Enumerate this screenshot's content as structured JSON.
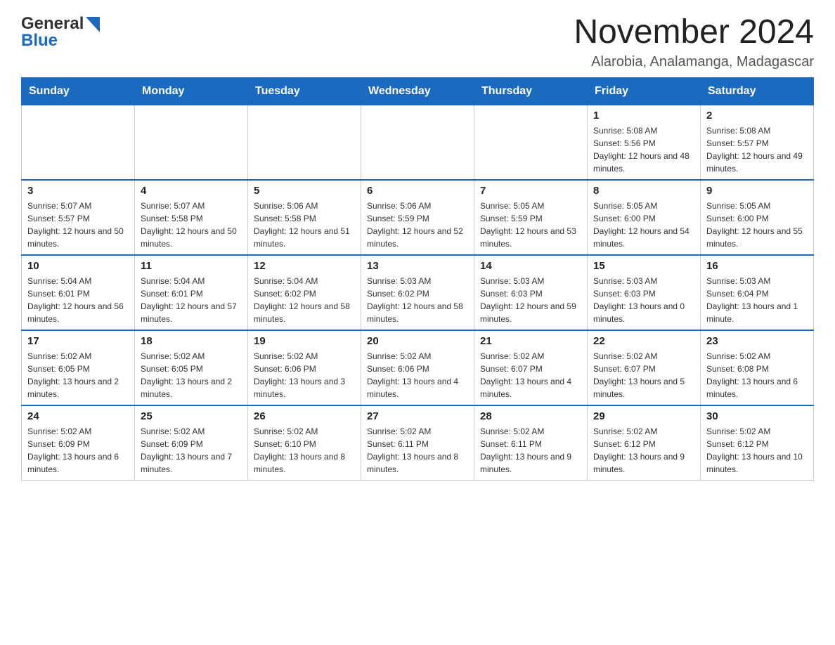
{
  "header": {
    "logo": {
      "general": "General",
      "blue": "Blue"
    },
    "title": "November 2024",
    "subtitle": "Alarobia, Analamanga, Madagascar"
  },
  "calendar": {
    "days_of_week": [
      "Sunday",
      "Monday",
      "Tuesday",
      "Wednesday",
      "Thursday",
      "Friday",
      "Saturday"
    ],
    "weeks": [
      [
        {
          "day": "",
          "info": ""
        },
        {
          "day": "",
          "info": ""
        },
        {
          "day": "",
          "info": ""
        },
        {
          "day": "",
          "info": ""
        },
        {
          "day": "",
          "info": ""
        },
        {
          "day": "1",
          "info": "Sunrise: 5:08 AM\nSunset: 5:56 PM\nDaylight: 12 hours and 48 minutes."
        },
        {
          "day": "2",
          "info": "Sunrise: 5:08 AM\nSunset: 5:57 PM\nDaylight: 12 hours and 49 minutes."
        }
      ],
      [
        {
          "day": "3",
          "info": "Sunrise: 5:07 AM\nSunset: 5:57 PM\nDaylight: 12 hours and 50 minutes."
        },
        {
          "day": "4",
          "info": "Sunrise: 5:07 AM\nSunset: 5:58 PM\nDaylight: 12 hours and 50 minutes."
        },
        {
          "day": "5",
          "info": "Sunrise: 5:06 AM\nSunset: 5:58 PM\nDaylight: 12 hours and 51 minutes."
        },
        {
          "day": "6",
          "info": "Sunrise: 5:06 AM\nSunset: 5:59 PM\nDaylight: 12 hours and 52 minutes."
        },
        {
          "day": "7",
          "info": "Sunrise: 5:05 AM\nSunset: 5:59 PM\nDaylight: 12 hours and 53 minutes."
        },
        {
          "day": "8",
          "info": "Sunrise: 5:05 AM\nSunset: 6:00 PM\nDaylight: 12 hours and 54 minutes."
        },
        {
          "day": "9",
          "info": "Sunrise: 5:05 AM\nSunset: 6:00 PM\nDaylight: 12 hours and 55 minutes."
        }
      ],
      [
        {
          "day": "10",
          "info": "Sunrise: 5:04 AM\nSunset: 6:01 PM\nDaylight: 12 hours and 56 minutes."
        },
        {
          "day": "11",
          "info": "Sunrise: 5:04 AM\nSunset: 6:01 PM\nDaylight: 12 hours and 57 minutes."
        },
        {
          "day": "12",
          "info": "Sunrise: 5:04 AM\nSunset: 6:02 PM\nDaylight: 12 hours and 58 minutes."
        },
        {
          "day": "13",
          "info": "Sunrise: 5:03 AM\nSunset: 6:02 PM\nDaylight: 12 hours and 58 minutes."
        },
        {
          "day": "14",
          "info": "Sunrise: 5:03 AM\nSunset: 6:03 PM\nDaylight: 12 hours and 59 minutes."
        },
        {
          "day": "15",
          "info": "Sunrise: 5:03 AM\nSunset: 6:03 PM\nDaylight: 13 hours and 0 minutes."
        },
        {
          "day": "16",
          "info": "Sunrise: 5:03 AM\nSunset: 6:04 PM\nDaylight: 13 hours and 1 minute."
        }
      ],
      [
        {
          "day": "17",
          "info": "Sunrise: 5:02 AM\nSunset: 6:05 PM\nDaylight: 13 hours and 2 minutes."
        },
        {
          "day": "18",
          "info": "Sunrise: 5:02 AM\nSunset: 6:05 PM\nDaylight: 13 hours and 2 minutes."
        },
        {
          "day": "19",
          "info": "Sunrise: 5:02 AM\nSunset: 6:06 PM\nDaylight: 13 hours and 3 minutes."
        },
        {
          "day": "20",
          "info": "Sunrise: 5:02 AM\nSunset: 6:06 PM\nDaylight: 13 hours and 4 minutes."
        },
        {
          "day": "21",
          "info": "Sunrise: 5:02 AM\nSunset: 6:07 PM\nDaylight: 13 hours and 4 minutes."
        },
        {
          "day": "22",
          "info": "Sunrise: 5:02 AM\nSunset: 6:07 PM\nDaylight: 13 hours and 5 minutes."
        },
        {
          "day": "23",
          "info": "Sunrise: 5:02 AM\nSunset: 6:08 PM\nDaylight: 13 hours and 6 minutes."
        }
      ],
      [
        {
          "day": "24",
          "info": "Sunrise: 5:02 AM\nSunset: 6:09 PM\nDaylight: 13 hours and 6 minutes."
        },
        {
          "day": "25",
          "info": "Sunrise: 5:02 AM\nSunset: 6:09 PM\nDaylight: 13 hours and 7 minutes."
        },
        {
          "day": "26",
          "info": "Sunrise: 5:02 AM\nSunset: 6:10 PM\nDaylight: 13 hours and 8 minutes."
        },
        {
          "day": "27",
          "info": "Sunrise: 5:02 AM\nSunset: 6:11 PM\nDaylight: 13 hours and 8 minutes."
        },
        {
          "day": "28",
          "info": "Sunrise: 5:02 AM\nSunset: 6:11 PM\nDaylight: 13 hours and 9 minutes."
        },
        {
          "day": "29",
          "info": "Sunrise: 5:02 AM\nSunset: 6:12 PM\nDaylight: 13 hours and 9 minutes."
        },
        {
          "day": "30",
          "info": "Sunrise: 5:02 AM\nSunset: 6:12 PM\nDaylight: 13 hours and 10 minutes."
        }
      ]
    ]
  }
}
